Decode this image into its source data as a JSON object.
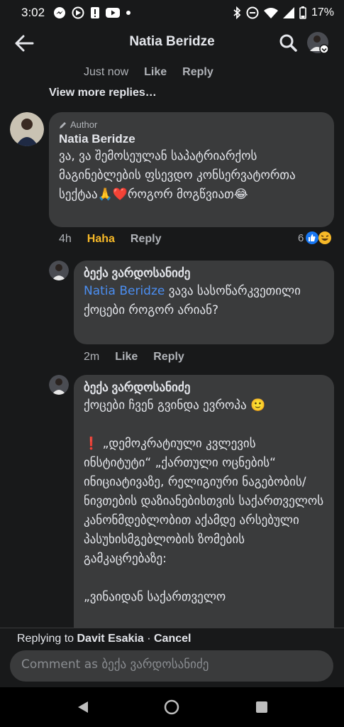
{
  "status_bar": {
    "time": "3:02",
    "battery": "17%",
    "left_icons": [
      "messenger-icon",
      "sync-icon",
      "alert-icon",
      "youtube-icon",
      "dot-icon"
    ],
    "right_icons": [
      "bluetooth-icon",
      "do-not-disturb-icon",
      "wifi-icon",
      "signal-icon",
      "battery-icon"
    ]
  },
  "header": {
    "title": "Natia Beridze",
    "back_icon": "arrow-left-icon",
    "search_icon": "search-icon"
  },
  "top_actions": {
    "time": "Just now",
    "like": "Like",
    "reply": "Reply"
  },
  "view_more": "View more replies…",
  "comments": [
    {
      "author_badge": "Author",
      "name": "Natia Beridze",
      "text": "ვა, ვა შემოსეულან საპატრიარქოს მაგინებლების ფსევდო კონსერვატორთა სექტაა🙏❤️როგორ მოგწვიათ😂",
      "time": "4h",
      "reaction_label": "Haha",
      "reply": "Reply",
      "reaction_count": "6"
    },
    {
      "name": "ბექა ვარდოსანიძე",
      "mention": "Natia Beridze",
      "text": " ვავა სასოწარკვეთილი ქოცები როგორ არიან?",
      "time": "2m",
      "like": "Like",
      "reply": "Reply"
    },
    {
      "name": "ბექა ვარდოსანიძე",
      "text": "ქოცები ჩვენ გვინდა ევროპა 🙂\n\n❗ „დემოკრატიული კვლევის ინსტიტუტი“ „ქართული ოცნების“ ინიციატივაზე, რელიგიური ნაგებობის/ნივთების დაზიანებისთვის საქართველოს კანონმდებლობით აქამდე არსებული პასუხისმგებლობის ზომების გამკაცრებაზე:\n\n„ვინაიდან საქართველო"
    }
  ],
  "reply_bar": {
    "prefix": "Replying to",
    "target": "Davit Esakia",
    "separator": " · ",
    "cancel": "Cancel"
  },
  "comment_input": {
    "placeholder": "Comment as ბექა ვარდოსანიძე"
  },
  "nav": {
    "back_icon": "triangle-back-icon",
    "home_icon": "circle-home-icon",
    "recents_icon": "square-recents-icon"
  },
  "colors": {
    "background": "#18191a",
    "bubble": "#3a3b3c",
    "mention": "#4b8ef1",
    "haha": "#f7b928",
    "secondary_text": "#b0b3b8"
  }
}
